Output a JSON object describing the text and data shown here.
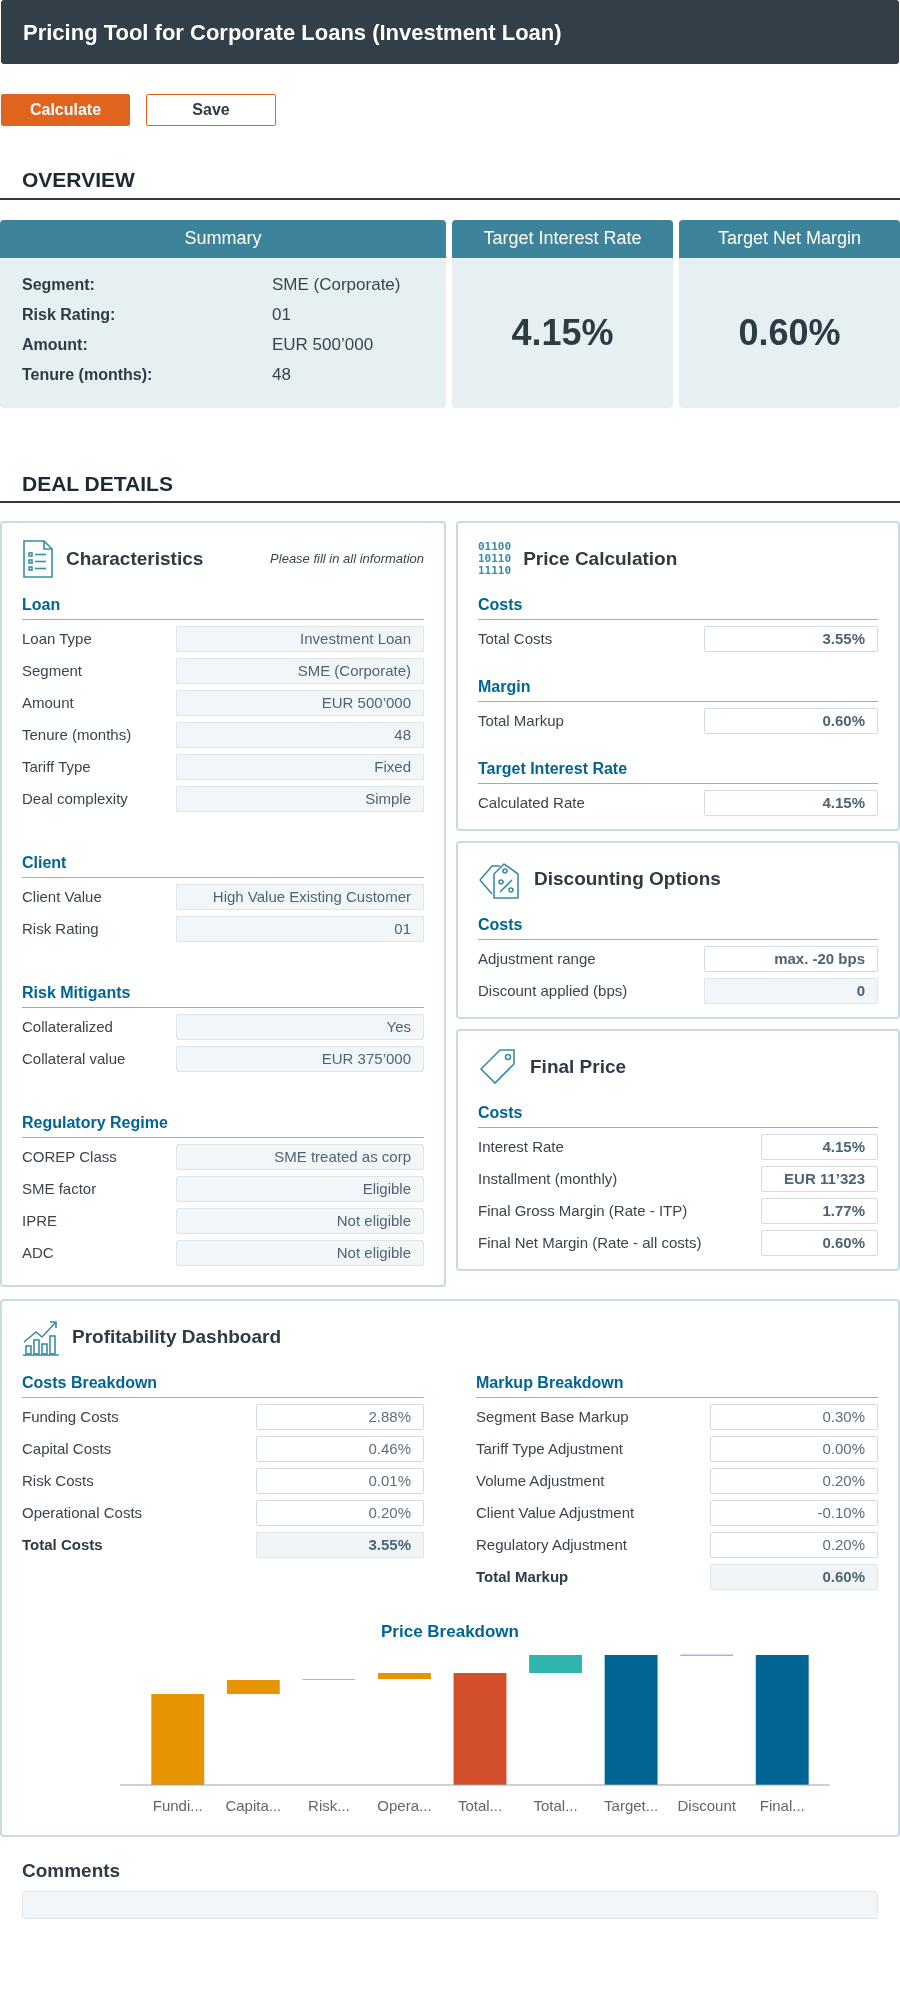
{
  "header": {
    "title": "Pricing Tool for Corporate Loans (Investment Loan)"
  },
  "actions": [
    {
      "label": "Calculate",
      "kind": "primary"
    },
    {
      "label": "Save",
      "kind": "secondary"
    }
  ],
  "overview": {
    "heading": "OVERVIEW",
    "summary": {
      "title": "Summary",
      "rows": [
        {
          "label": "Segment:",
          "value": "SME (Corporate)"
        },
        {
          "label": "Risk Rating:",
          "value": "01"
        },
        {
          "label": "Amount:",
          "value": "EUR 500’000"
        },
        {
          "label": "Tenure (months):",
          "value": "48"
        }
      ]
    },
    "kpis": [
      {
        "title": "Target Interest Rate",
        "value": "4.15%"
      },
      {
        "title": "Target Net Margin",
        "value": "0.60%"
      }
    ]
  },
  "deal_details": {
    "heading": "DEAL DETAILS",
    "characteristics": {
      "title": "Characteristics",
      "note": "Please fill in all information",
      "sections": [
        {
          "title": "Loan",
          "rows": [
            {
              "label": "Loan Type",
              "value": "Investment Loan",
              "kind": "input"
            },
            {
              "label": "Segment",
              "value": "SME (Corporate)",
              "kind": "input"
            },
            {
              "label": "Amount",
              "value": "EUR 500’000",
              "kind": "input"
            },
            {
              "label": "Tenure (months)",
              "value": "48",
              "kind": "input"
            },
            {
              "label": "Tariff Type",
              "value": "Fixed",
              "kind": "input"
            },
            {
              "label": "Deal complexity",
              "value": "Simple",
              "kind": "input"
            }
          ]
        },
        {
          "title": "Client",
          "rows": [
            {
              "label": "Client Value",
              "value": "High Value Existing Customer",
              "kind": "input"
            },
            {
              "label": "Risk Rating",
              "value": "01",
              "kind": "input"
            }
          ]
        },
        {
          "title": "Risk Mitigants",
          "rows": [
            {
              "label": "Collateralized",
              "value": "Yes",
              "kind": "input"
            },
            {
              "label": "Collateral value",
              "value": "EUR 375’000",
              "kind": "input"
            }
          ]
        },
        {
          "title": "Regulatory Regime",
          "rows": [
            {
              "label": "COREP Class",
              "value": "SME treated as corp",
              "kind": "input"
            },
            {
              "label": "SME factor",
              "value": "Eligible",
              "kind": "input"
            },
            {
              "label": "IPRE",
              "value": "Not eligible",
              "kind": "input"
            },
            {
              "label": "ADC",
              "value": "Not eligible",
              "kind": "input"
            }
          ]
        }
      ]
    },
    "price_calculation": {
      "title": "Price Calculation",
      "icon_digits": [
        "01100",
        "10110",
        "11110"
      ],
      "sections": [
        {
          "title": "Costs",
          "rows": [
            {
              "label": "Total Costs",
              "value": "3.55%",
              "kind": "result"
            }
          ]
        },
        {
          "title": "Margin",
          "rows": [
            {
              "label": "Total Markup",
              "value": "0.60%",
              "kind": "result"
            }
          ]
        },
        {
          "title": "Target Interest Rate",
          "rows": [
            {
              "label": "Calculated Rate",
              "value": "4.15%",
              "kind": "result"
            }
          ]
        }
      ]
    },
    "discounting_options": {
      "title": "Discounting Options",
      "sections": [
        {
          "title": "Costs",
          "rows": [
            {
              "label": "Adjustment range",
              "value": "max. -20 bps",
              "kind": "result"
            },
            {
              "label": "Discount applied (bps)",
              "value": "0",
              "kind": "entry"
            }
          ]
        }
      ]
    },
    "final_price": {
      "title": "Final Price",
      "sections": [
        {
          "title": "Costs",
          "rows": [
            {
              "label": "Interest Rate",
              "value": "4.15%",
              "kind": "result"
            },
            {
              "label": "Installment (monthly)",
              "value": "EUR 11’323",
              "kind": "result"
            },
            {
              "label": "Final Gross Margin (Rate - ITP)",
              "value": "1.77%",
              "kind": "result"
            },
            {
              "label": "Final Net Margin (Rate - all costs)",
              "value": "0.60%",
              "kind": "result"
            }
          ]
        }
      ]
    }
  },
  "profitability": {
    "title": "Profitability Dashboard",
    "breakdowns": [
      {
        "title": "Costs Breakdown",
        "rows": [
          {
            "label": "Funding Costs",
            "value": "2.88%",
            "kind": "breakdown"
          },
          {
            "label": "Capital Costs",
            "value": "0.46%",
            "kind": "breakdown"
          },
          {
            "label": "Risk Costs",
            "value": "0.01%",
            "kind": "breakdown"
          },
          {
            "label": "Operational Costs",
            "value": "0.20%",
            "kind": "breakdown"
          },
          {
            "label": "Total Costs",
            "value": "3.55%",
            "kind": "total"
          }
        ]
      },
      {
        "title": "Markup Breakdown",
        "rows": [
          {
            "label": "Segment Base Markup",
            "value": "0.30%",
            "kind": "breakdown"
          },
          {
            "label": "Tariff Type Adjustment",
            "value": "0.00%",
            "kind": "breakdown"
          },
          {
            "label": "Volume Adjustment",
            "value": "0.20%",
            "kind": "breakdown"
          },
          {
            "label": "Client Value Adjustment",
            "value": "-0.10%",
            "kind": "breakdown"
          },
          {
            "label": "Regulatory Adjustment",
            "value": "0.20%",
            "kind": "breakdown"
          },
          {
            "label": "Total Markup",
            "value": "0.60%",
            "kind": "total"
          }
        ]
      }
    ],
    "price_breakdown": {
      "title": "Price Breakdown",
      "categories": [
        "Fundi...",
        "Capita...",
        "Risk...",
        "Opera...",
        "Total...",
        "Total...",
        "Target...",
        "Discount",
        "Final..."
      ]
    }
  },
  "comments": {
    "title": "Comments"
  }
}
